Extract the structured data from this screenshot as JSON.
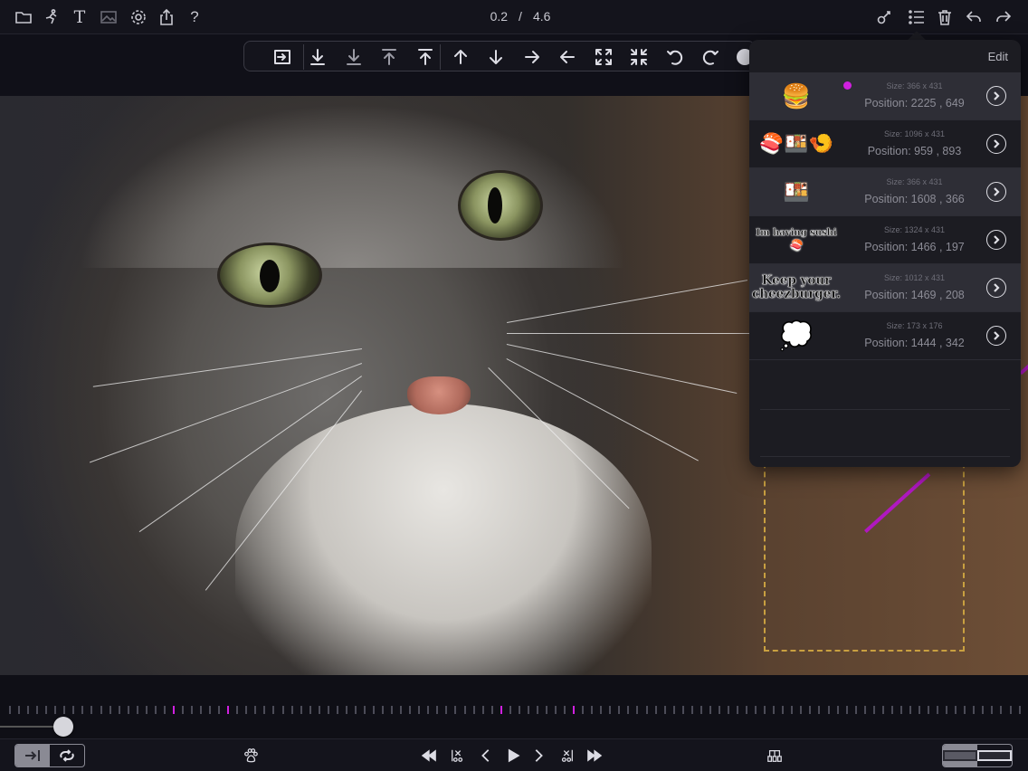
{
  "topbar": {
    "time_current": "0.2",
    "time_separator": "/",
    "time_total": "4.6",
    "left_icons": [
      "folder-icon",
      "animate-figure-icon",
      "text-icon",
      "image-icon",
      "settings-gear-icon",
      "share-export-icon",
      "help-question-icon"
    ],
    "right_icons": [
      "effects-icon",
      "layers-list-icon",
      "trash-icon",
      "undo-icon",
      "redo-icon"
    ]
  },
  "toolbar": {
    "tools": [
      "fit-to-frame-icon",
      "move-to-bottom-icon",
      "move-down-layer-icon",
      "move-up-layer-icon",
      "move-to-top-icon",
      "nudge-up-icon",
      "nudge-down-icon",
      "nudge-right-icon",
      "nudge-left-icon",
      "expand-icon",
      "shrink-icon",
      "rotate-left-icon",
      "rotate-right-icon",
      "opacity-icon"
    ]
  },
  "layers_panel": {
    "edit_label": "Edit",
    "items": [
      {
        "thumb": "🍔",
        "size": "Size: 366 x 431",
        "position": "Position: 2225 , 649",
        "selected": true
      },
      {
        "thumb": "🍣🍱🍤",
        "size": "Size: 1096 x 431",
        "position": "Position: 959 , 893",
        "selected": false
      },
      {
        "thumb": "🍱",
        "size": "Size: 366 x 431",
        "position": "Position: 1608 , 366",
        "selected": true
      },
      {
        "thumb": "Im having sushi",
        "thumb_sub": "🍣",
        "size": "Size: 1324 x 431",
        "position": "Position: 1466 , 197",
        "selected": false
      },
      {
        "thumb": "Keep your cheezburger.",
        "size": "Size: 1012 x 431",
        "position": "Position: 1469 , 208",
        "selected": true
      },
      {
        "thumb": "💭",
        "size": "Size: 173 x 176",
        "position": "Position: 1444 , 342",
        "selected": false
      }
    ]
  },
  "timeline": {
    "playhead_fraction": 0.06,
    "keyframe_color": "#d020e0"
  },
  "bottombar": {
    "left_toggle": [
      "play-to-end-icon",
      "loop-icon"
    ],
    "paw_icon": "paw-icon",
    "transport": [
      "rewind-icon",
      "trim-start-icon",
      "step-back-icon",
      "play-icon",
      "step-forward-icon",
      "trim-end-icon",
      "fast-forward-icon"
    ],
    "film_icon": "filmstrip-icon",
    "right_toggle": [
      "canvas-view-icon",
      "preview-view-icon"
    ]
  },
  "colors": {
    "accent_magenta": "#b018c0",
    "selection_border": "#c9a040"
  }
}
